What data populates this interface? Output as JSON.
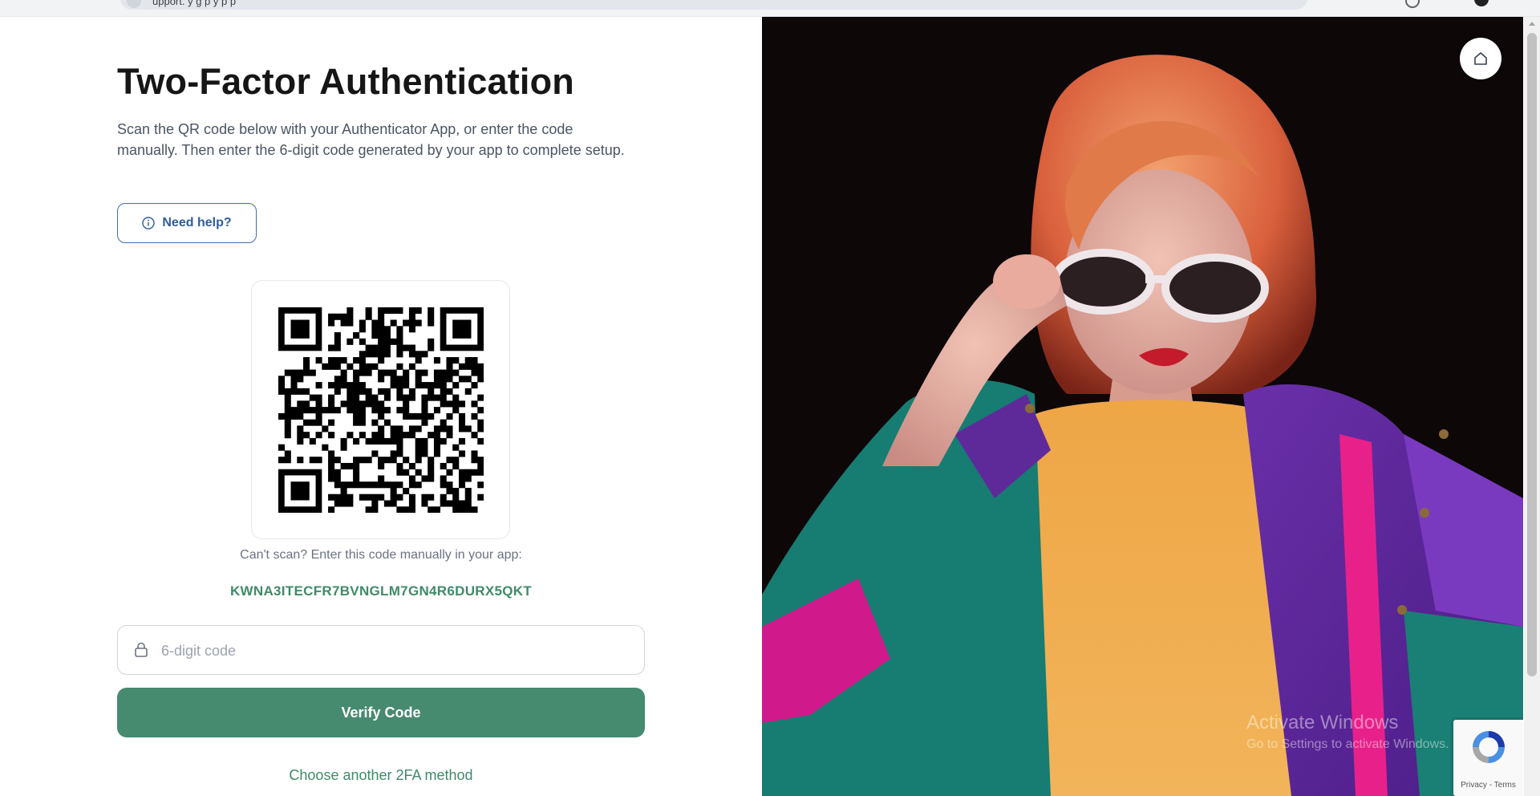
{
  "browser": {
    "url_text": "upport.  y g  p  y   p  p  "
  },
  "left": {
    "title": "Two-Factor Authentication",
    "description": "Scan the QR code below with your Authenticator App, or enter the code manually. Then enter the 6-digit code generated by your app to complete setup.",
    "help_label": "Need help?",
    "cant_scan": "Can't scan? Enter this code manually in your app:",
    "secret_code": "KWNA3ITECFR7BVNGLM7GN4R6DURX5QKT",
    "code_placeholder": "6-digit code",
    "verify_label": "Verify Code",
    "another_method": "Choose another 2FA method"
  },
  "right": {
    "watermark_line1": "Activate Windows",
    "watermark_line2": "Go to Settings to activate Windows.",
    "recaptcha_terms": "Privacy - Terms"
  },
  "colors": {
    "primary_green": "#468a70",
    "link_green": "#3f8a6a",
    "help_blue": "#2f5d9e"
  }
}
